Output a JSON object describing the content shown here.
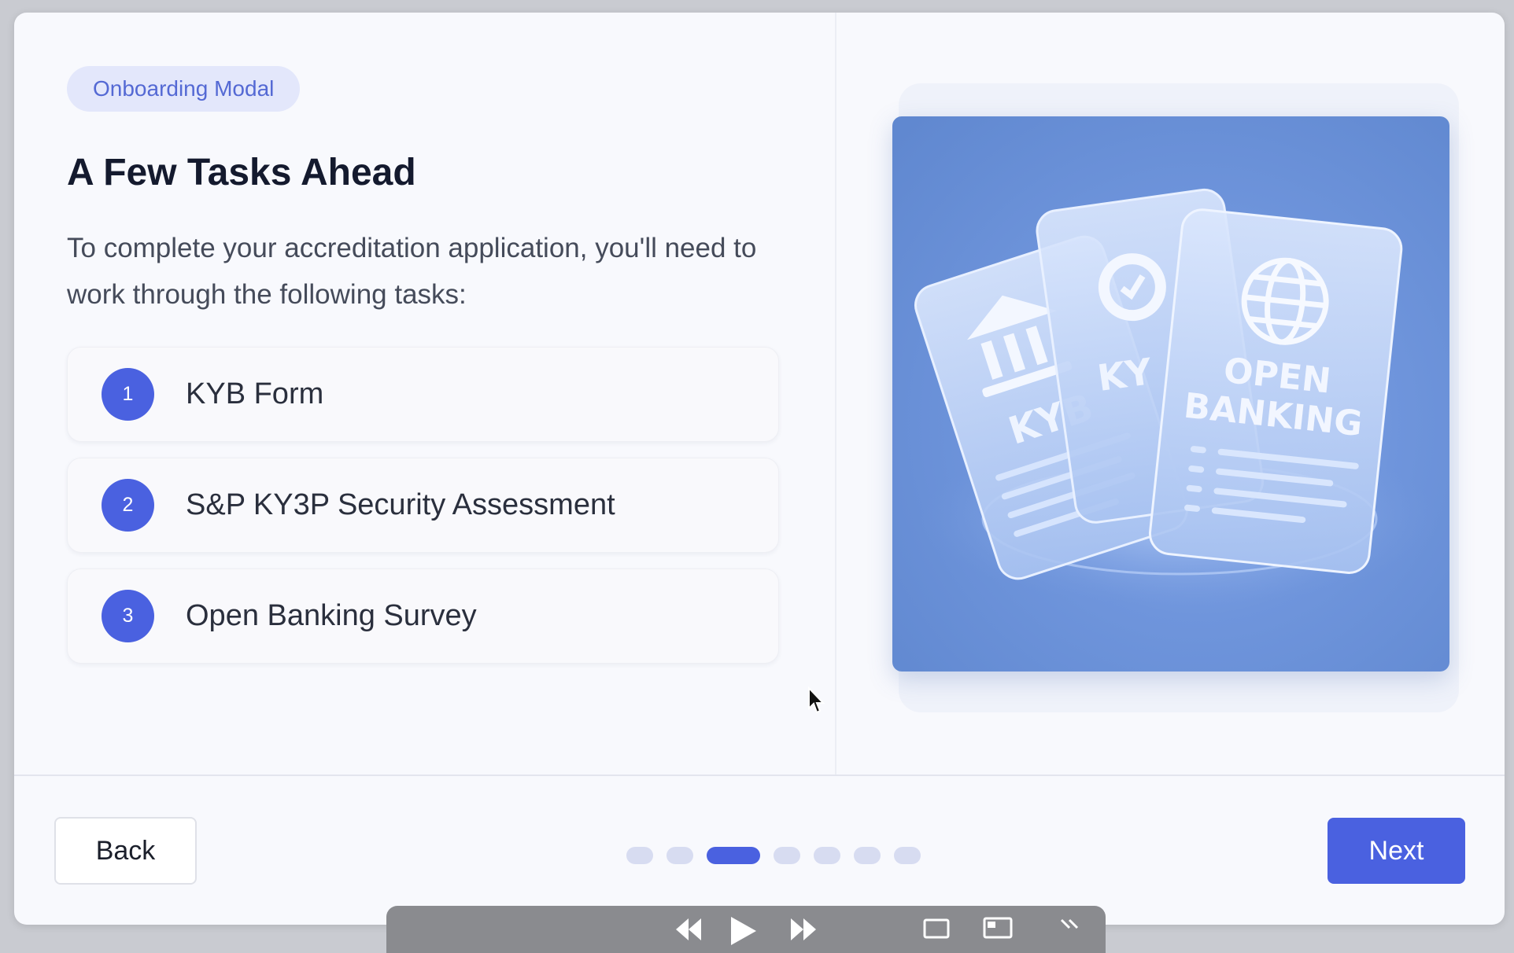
{
  "modal": {
    "badge": "Onboarding Modal",
    "title": "A Few Tasks Ahead",
    "description": "To complete your accreditation application, you'll need to work through the following tasks:",
    "tasks": [
      {
        "number": "1",
        "label": "KYB Form"
      },
      {
        "number": "2",
        "label": "S&P KY3P Security Assessment"
      },
      {
        "number": "3",
        "label": "Open Banking Survey"
      }
    ],
    "illustration": {
      "card_labels": [
        "KYB",
        "KY",
        "OPEN",
        "BANKING"
      ],
      "icons": [
        "bank-icon",
        "gear-icon",
        "globe-icon"
      ],
      "background_color": "#6f95dc"
    }
  },
  "footer": {
    "back_label": "Back",
    "next_label": "Next",
    "pagination": {
      "total": 7,
      "current": 3
    }
  },
  "colors": {
    "accent": "#4a61e0",
    "badge_bg": "#e3e7fb",
    "badge_text": "#5469d4",
    "modal_bg": "#f8f9fd"
  },
  "media_bar": {
    "icons": [
      "rewind-icon",
      "play-icon",
      "fast-forward-icon",
      "subtitles-icon",
      "pip-icon",
      "more-icon"
    ]
  }
}
